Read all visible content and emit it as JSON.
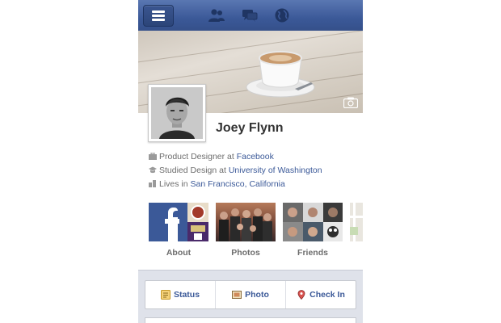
{
  "profile": {
    "name": "Joey Flynn"
  },
  "info": [
    {
      "prefix": "Product Designer at ",
      "link": "Facebook",
      "icon": "briefcase-icon"
    },
    {
      "prefix": "Studied Design at ",
      "link": "University of Washington",
      "icon": "graduation-cap-icon"
    },
    {
      "prefix": "Lives in ",
      "link": "San Francisco, California",
      "icon": "city-icon"
    }
  ],
  "tiles": [
    {
      "label": "About"
    },
    {
      "label": "Photos"
    },
    {
      "label": "Friends"
    }
  ],
  "composer": {
    "status_label": "Status",
    "photo_label": "Photo",
    "checkin_label": "Check In"
  },
  "icons": {
    "menu": "menu-icon",
    "friend_requests": "friends-icon",
    "messages": "messages-icon",
    "notifications": "globe-icon",
    "cover_camera": "camera-icon"
  },
  "colors": {
    "brand_blue": "#3b5998",
    "text_gray": "#6d6d6d",
    "name_text": "#333333"
  }
}
